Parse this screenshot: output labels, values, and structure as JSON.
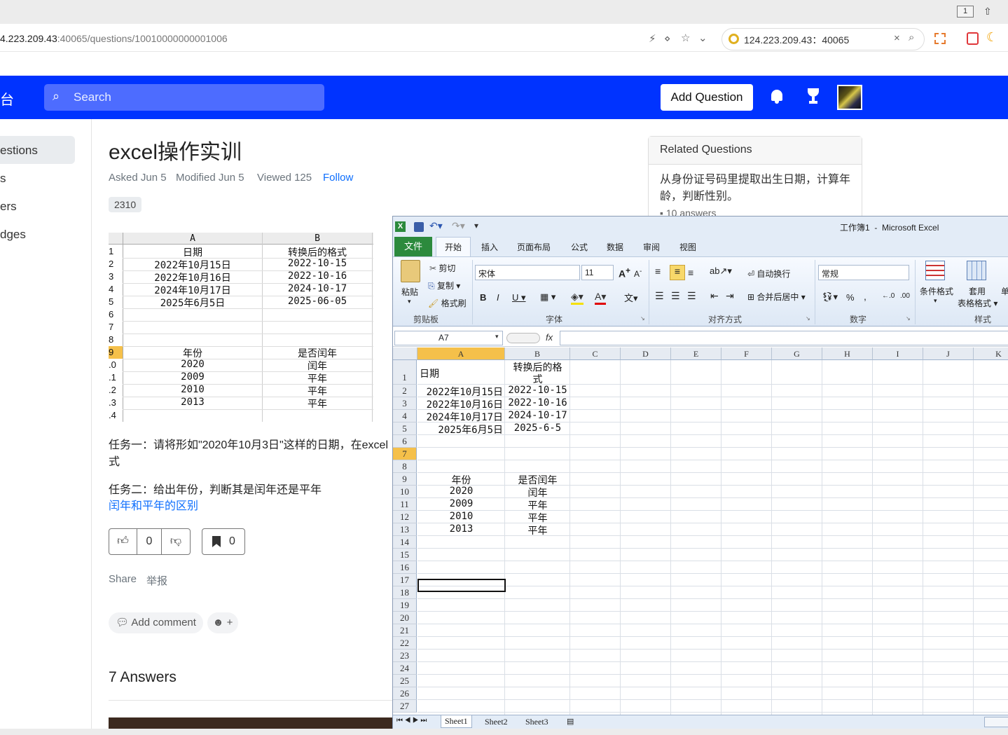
{
  "browser": {
    "tab_count": "1",
    "url_host": "124.223.209.43",
    "url_host_visible": "4.223.209.43",
    "url_rest": ":40065/questions/10010000000001006",
    "search_engine_text": "124.223.209.43：40065"
  },
  "site": {
    "brand_fragment": "台",
    "search_placeholder": "Search",
    "add_question_label": "Add Question"
  },
  "sidebar": {
    "items": [
      {
        "label": "estions"
      },
      {
        "label": "s"
      },
      {
        "label": "ers"
      },
      {
        "label": "dges"
      }
    ]
  },
  "question": {
    "title": "excel操作实训",
    "asked": "Asked Jun 5",
    "modified": "Modified Jun 5",
    "viewed": "Viewed 125",
    "follow_label": "Follow",
    "tag": "2310",
    "task1_line1": "任务一：请将形如\"2020年10月3日\"这样的日期，在excel",
    "task1_line2": "式",
    "task2": "任务二：给出年份，判断其是闰年还是平年",
    "link": "闰年和平年的区别",
    "upvotes": "0",
    "bookmarks": "0",
    "share_label": "Share",
    "report_label": "举报",
    "add_comment_label": "Add comment",
    "emoji_plus": "+",
    "answers_count": "7 Answers"
  },
  "embedded_sheet": {
    "col_a": "A",
    "col_b": "B",
    "rows": [
      {
        "n": "1",
        "a": "日期",
        "b": "转换后的格式"
      },
      {
        "n": "2",
        "a": "2022年10月15日",
        "b": "2022-10-15"
      },
      {
        "n": "3",
        "a": "2022年10月16日",
        "b": "2022-10-16"
      },
      {
        "n": "4",
        "a": "2024年10月17日",
        "b": "2024-10-17"
      },
      {
        "n": "5",
        "a": "2025年6月5日",
        "b": "2025-06-05"
      },
      {
        "n": "6",
        "a": "",
        "b": ""
      },
      {
        "n": "7",
        "a": "",
        "b": ""
      },
      {
        "n": "8",
        "a": "",
        "b": ""
      },
      {
        "n": "9",
        "a": "年份",
        "b": "是否闰年"
      },
      {
        "n": ".0",
        "a": "2020",
        "b": "闰年"
      },
      {
        "n": ".1",
        "a": "2009",
        "b": "平年"
      },
      {
        "n": ".2",
        "a": "2010",
        "b": "平年"
      },
      {
        "n": ".3",
        "a": "2013",
        "b": "平年"
      },
      {
        "n": ".4",
        "a": "",
        "b": ""
      }
    ]
  },
  "related": {
    "heading": "Related Questions",
    "item_title": "从身份证号码里提取出生日期，计算年龄，判断性别。",
    "item_answers": "10 answers"
  },
  "excel": {
    "title": "工作簿1  -  Microsoft Excel",
    "tabs": [
      "文件",
      "开始",
      "插入",
      "页面布局",
      "公式",
      "数据",
      "审阅",
      "视图"
    ],
    "clipboard": {
      "paste": "粘贴",
      "cut": "剪切",
      "copy": "复制",
      "format_painter": "格式刷",
      "group": "剪贴板"
    },
    "font": {
      "name": "宋体",
      "size": "11",
      "group": "字体"
    },
    "alignment": {
      "wrap": "自动换行",
      "merge": "合并后居中",
      "group": "对齐方式"
    },
    "number": {
      "format": "常规",
      "group": "数字"
    },
    "styles": {
      "conditional": "条件格式",
      "table1": "套用",
      "table2": "表格格式",
      "group": "样式",
      "cut_off": "单"
    },
    "name_box": "A7",
    "fx_label": "fx",
    "columns": [
      "A",
      "B",
      "C",
      "D",
      "E",
      "F",
      "G",
      "H",
      "I",
      "J",
      "K"
    ],
    "cells": {
      "a1": "日期",
      "b1_line1": "转换后的格",
      "b1_line2": "式",
      "a2": "2022年10月15日",
      "b2": "2022-10-15",
      "a3": "2022年10月16日",
      "b3": "2022-10-16",
      "a4": "2024年10月17日",
      "b4": "2024-10-17",
      "a5": "2025年6月5日",
      "b5": "2025-6-5",
      "a9": "年份",
      "b9": "是否闰年",
      "a10": "2020",
      "b10": "闰年",
      "a11": "2009",
      "b11": "平年",
      "a12": "2010",
      "b12": "平年",
      "a13": "2013",
      "b13": "平年"
    },
    "row_numbers": [
      "1",
      "2",
      "3",
      "4",
      "5",
      "6",
      "7",
      "8",
      "9",
      "10",
      "11",
      "12",
      "13",
      "14",
      "15",
      "16",
      "17",
      "18",
      "19",
      "20",
      "21",
      "22",
      "23",
      "24",
      "25",
      "26",
      "27"
    ],
    "sheets": [
      "Sheet1",
      "Sheet2",
      "Sheet3"
    ]
  },
  "colors": {
    "site_nav": "#0033ff",
    "link": "#0d6efd",
    "excel_green": "#2c8a3d",
    "selected_header": "#f5c04a"
  }
}
